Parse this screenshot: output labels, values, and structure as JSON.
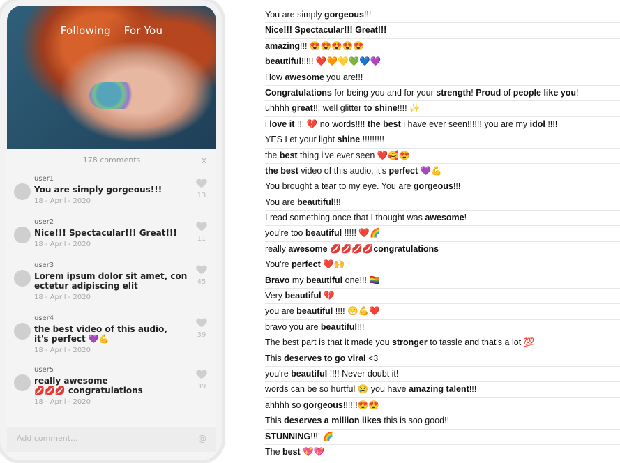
{
  "phone": {
    "tabs": [
      "Following",
      "For You"
    ],
    "comments_count_label": "178 comments",
    "close_label": "x",
    "comments": [
      {
        "user": "user1",
        "text": "You are simply gorgeous!!!",
        "date": "18 - April - 2020",
        "likes": "13"
      },
      {
        "user": "user2",
        "text": "Nice!!! Spectacular!!! Great!!!",
        "date": "18 - April - 2020",
        "likes": "11"
      },
      {
        "user": "user3",
        "text": "Lorem ipsum dolor sit amet, con\nectetur adipiscing elit",
        "date": "18 - April - 2020",
        "likes": "45"
      },
      {
        "user": "user4",
        "text": "the best video of this audio,\nit's perfect 💜💪",
        "date": "18 - April - 2020",
        "likes": "39"
      },
      {
        "user": "user5",
        "text": "really awesome\n💋💋💋 congratulations",
        "date": "18 - April - 2020",
        "likes": "39"
      }
    ],
    "add_comment_placeholder": "Add comment...",
    "at_symbol": "@"
  },
  "comment_list": [
    {
      "parts": [
        [
          "You are simply ",
          false
        ],
        [
          "gorgeous",
          true
        ],
        [
          "!!!",
          false
        ]
      ]
    },
    {
      "parts": [
        [
          "Nice!!! Spectacular!!! Great!!!",
          true
        ]
      ]
    },
    {
      "parts": [
        [
          "amazing",
          true
        ],
        [
          "!!! 😍😍😍😍😍",
          false
        ]
      ]
    },
    {
      "parts": [
        [
          "beautiful",
          true
        ],
        [
          "!!!!! ❤️🧡💛💚💙💜",
          false
        ]
      ]
    },
    {
      "parts": [
        [
          "How ",
          false
        ],
        [
          "awesome",
          true
        ],
        [
          " you are!!!",
          false
        ]
      ]
    },
    {
      "parts": [
        [
          "Congratulations",
          true
        ],
        [
          " for being you and for your ",
          false
        ],
        [
          "strength",
          true
        ],
        [
          "! ",
          false
        ],
        [
          "Proud",
          true
        ],
        [
          " of ",
          false
        ],
        [
          "people like you",
          true
        ],
        [
          "!",
          false
        ]
      ]
    },
    {
      "parts": [
        [
          "uhhhh ",
          false
        ],
        [
          "great",
          true
        ],
        [
          "!!! well glitter ",
          false
        ],
        [
          "to shine",
          true
        ],
        [
          "!!!! ✨",
          false
        ]
      ]
    },
    {
      "parts": [
        [
          "i ",
          false
        ],
        [
          "love it",
          true
        ],
        [
          " !!! 💔 no words!!!! ",
          false
        ],
        [
          "the best",
          true
        ],
        [
          " i have ever seen!!!!!! you are my ",
          false
        ],
        [
          "idol",
          true
        ],
        [
          " !!!!",
          false
        ]
      ]
    },
    {
      "parts": [
        [
          "YES Let your light ",
          false
        ],
        [
          "shine",
          true
        ],
        [
          " !!!!!!!!!",
          false
        ]
      ]
    },
    {
      "parts": [
        [
          "the ",
          false
        ],
        [
          "best",
          true
        ],
        [
          " thing i've ever seen ❤️🥰😍",
          false
        ]
      ]
    },
    {
      "parts": [
        [
          "the best",
          true
        ],
        [
          " video of this audio, it's ",
          false
        ],
        [
          "perfect",
          true
        ],
        [
          " 💜💪",
          false
        ]
      ]
    },
    {
      "parts": [
        [
          "You brought a tear to my eye. You are ",
          false
        ],
        [
          "gorgeous",
          true
        ],
        [
          "!!!",
          false
        ]
      ]
    },
    {
      "parts": [
        [
          "You are ",
          false
        ],
        [
          "beautiful",
          true
        ],
        [
          "!!!",
          false
        ]
      ]
    },
    {
      "parts": [
        [
          "I read something once that I thought was ",
          false
        ],
        [
          "awesome",
          true
        ],
        [
          "!",
          false
        ]
      ]
    },
    {
      "parts": [
        [
          "you're too ",
          false
        ],
        [
          "beautiful",
          true
        ],
        [
          " !!!!! ❤️🌈",
          false
        ]
      ]
    },
    {
      "parts": [
        [
          "really ",
          false
        ],
        [
          "awesome",
          true
        ],
        [
          " 💋💋💋💋",
          false
        ],
        [
          "congratulations",
          true
        ]
      ]
    },
    {
      "parts": [
        [
          "You're ",
          false
        ],
        [
          "perfect",
          true
        ],
        [
          " ❤️🙌",
          false
        ]
      ]
    },
    {
      "parts": [
        [
          "Bravo",
          true
        ],
        [
          " my ",
          false
        ],
        [
          "beautiful",
          true
        ],
        [
          " one!!! 🏳️‍🌈",
          false
        ]
      ]
    },
    {
      "parts": [
        [
          "Very ",
          false
        ],
        [
          "beautiful",
          true
        ],
        [
          " 💔",
          false
        ]
      ]
    },
    {
      "parts": [
        [
          "you are ",
          false
        ],
        [
          "beautiful",
          true
        ],
        [
          " !!!! 😁💪❤️",
          false
        ]
      ]
    },
    {
      "parts": [
        [
          "bravo you are ",
          false
        ],
        [
          "beautiful",
          true
        ],
        [
          "!!!",
          false
        ]
      ]
    },
    {
      "parts": [
        [
          "The best part is that it made you ",
          false
        ],
        [
          "stronger",
          true
        ],
        [
          " to tassle and that's a lot 💯",
          false
        ]
      ]
    },
    {
      "parts": [
        [
          "This ",
          false
        ],
        [
          "deserves to go viral",
          true
        ],
        [
          " <3",
          false
        ]
      ]
    },
    {
      "parts": [
        [
          "you're ",
          false
        ],
        [
          "beautiful",
          true
        ],
        [
          " !!!! Never doubt it!",
          false
        ]
      ]
    },
    {
      "parts": [
        [
          "words can be so hurtful 😢 you have ",
          false
        ],
        [
          "amazing talent",
          true
        ],
        [
          "!!!",
          false
        ]
      ]
    },
    {
      "parts": [
        [
          "ahhhh so ",
          false
        ],
        [
          "gorgeous",
          true
        ],
        [
          "!!!!!!😍😍",
          false
        ]
      ]
    },
    {
      "parts": [
        [
          "This ",
          false
        ],
        [
          "deserves a million likes",
          true
        ],
        [
          " this is soo good!!",
          false
        ]
      ]
    },
    {
      "parts": [
        [
          "STUNNING",
          true
        ],
        [
          "!!!! 🌈",
          false
        ]
      ]
    },
    {
      "parts": [
        [
          "The ",
          false
        ],
        [
          "best",
          true
        ],
        [
          " 💖💖",
          false
        ]
      ]
    }
  ]
}
